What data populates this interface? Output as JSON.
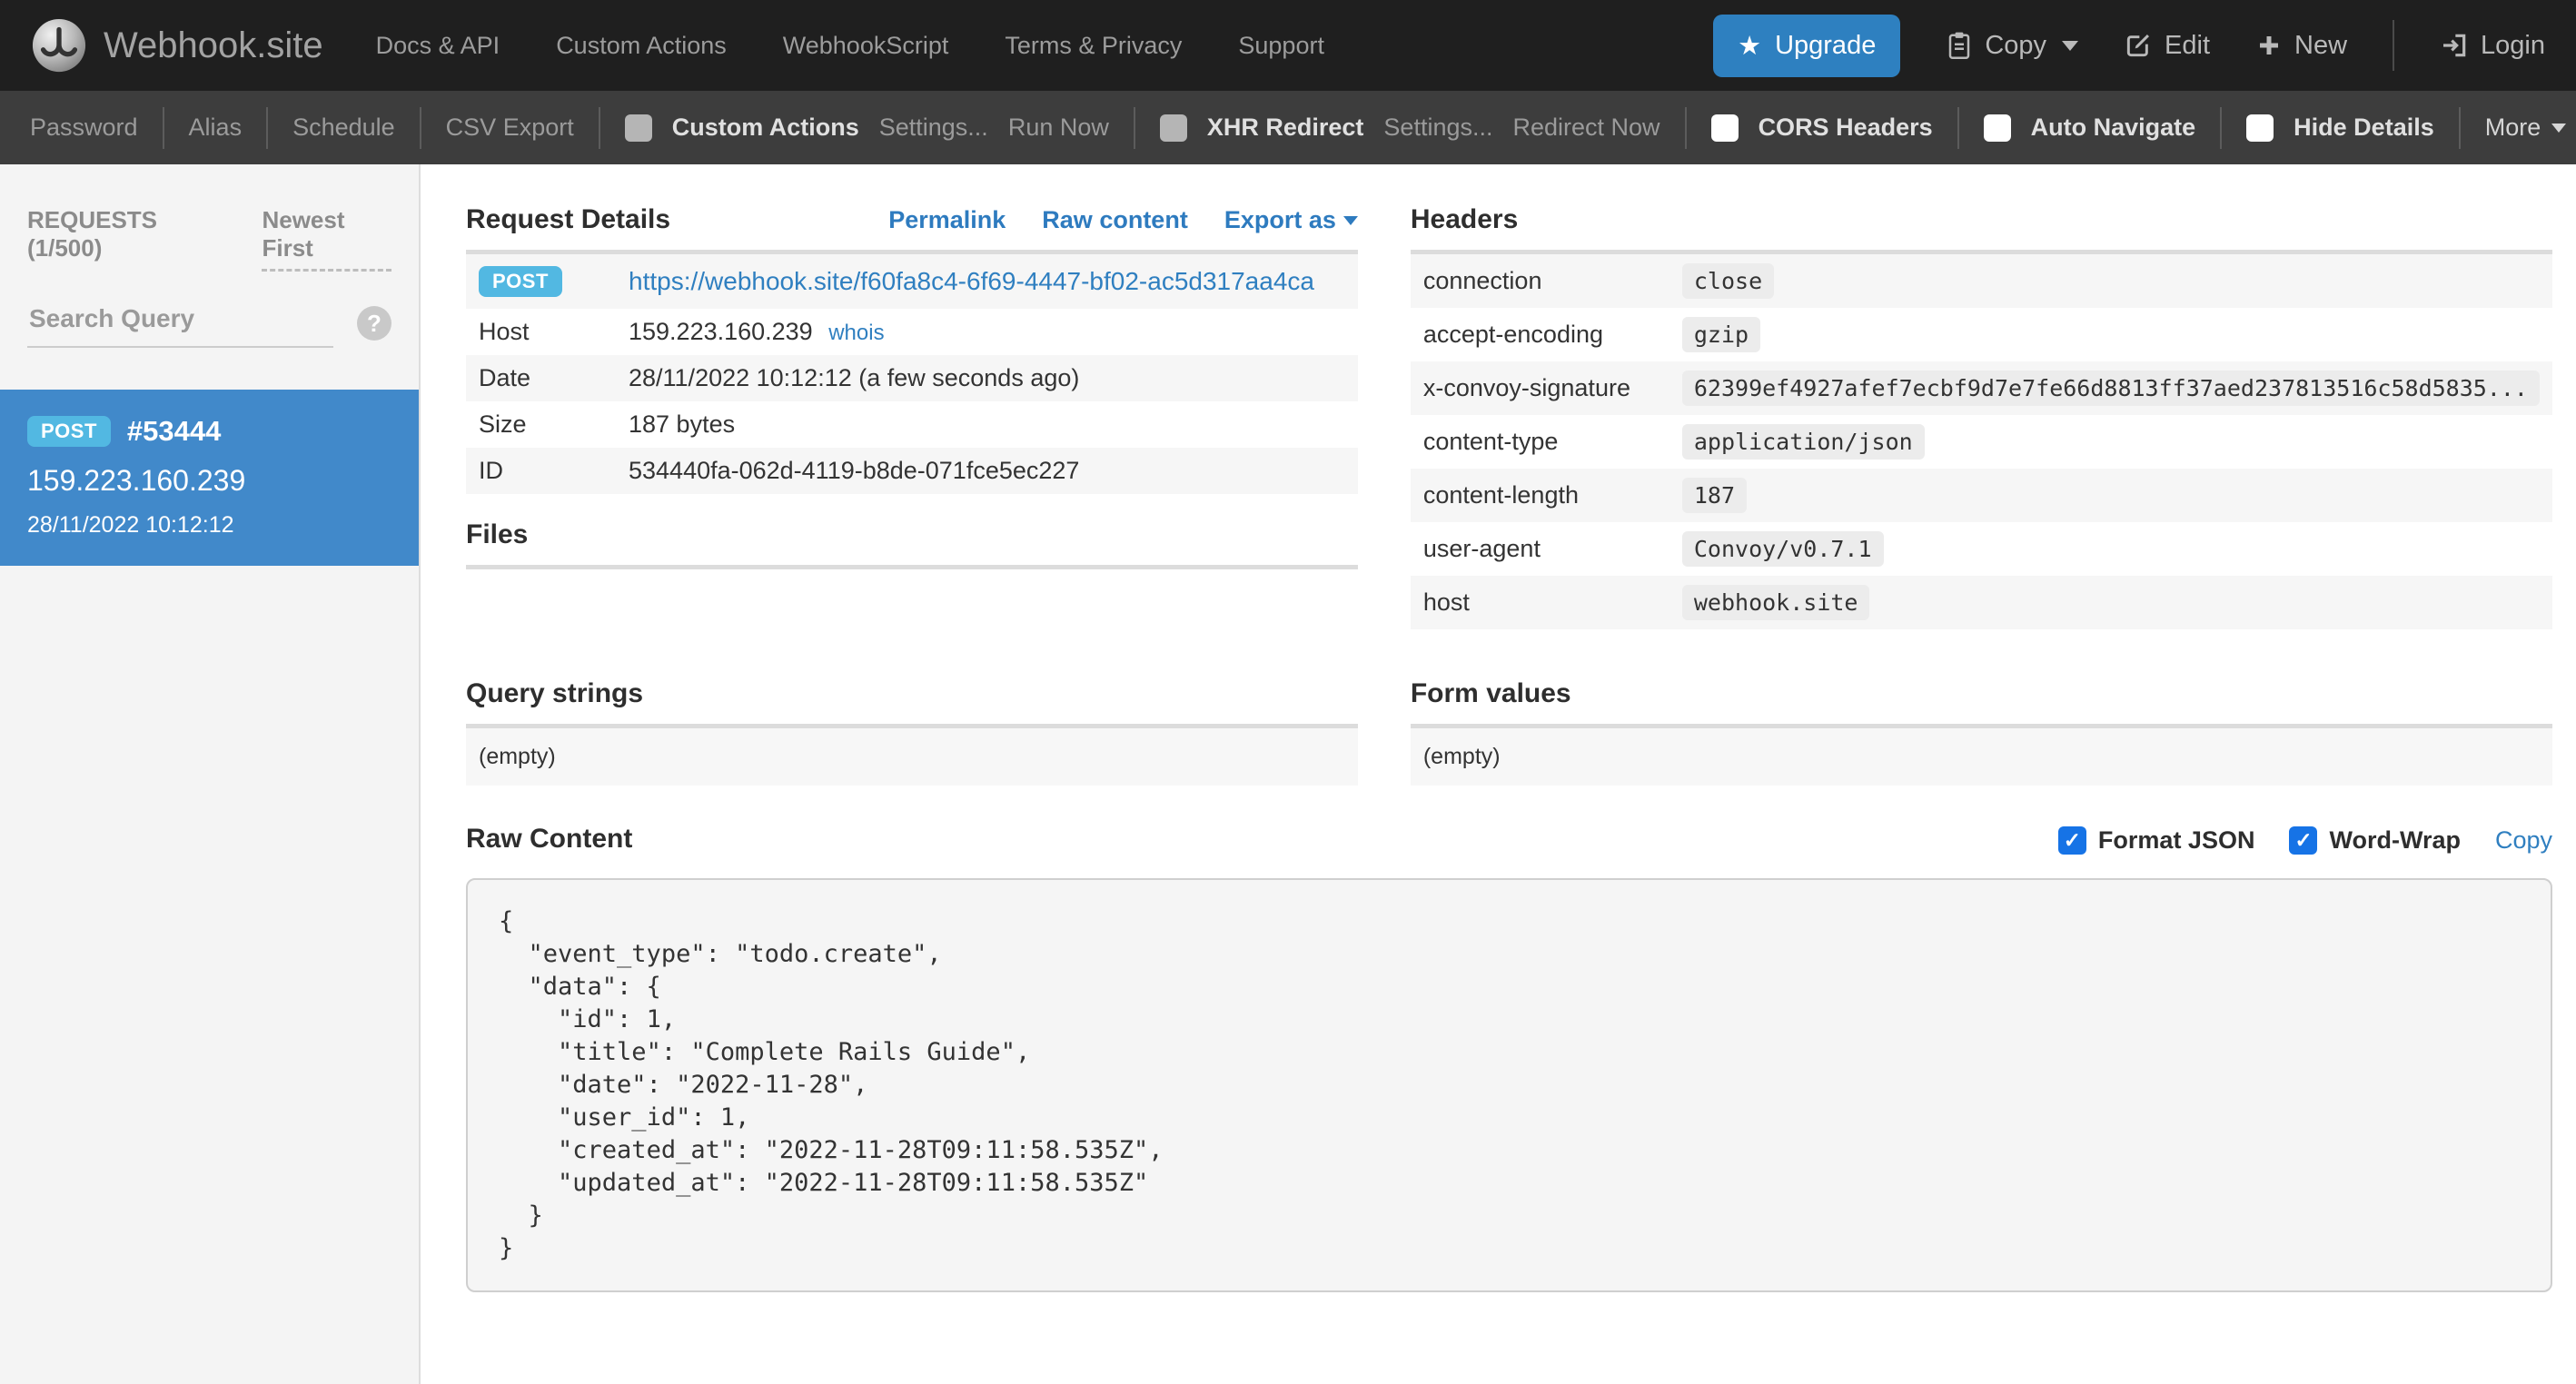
{
  "navbar": {
    "brand": "Webhook.site",
    "menu": [
      "Docs & API",
      "Custom Actions",
      "WebhookScript",
      "Terms & Privacy",
      "Support"
    ],
    "upgrade_label": "Upgrade",
    "copy_label": "Copy",
    "edit_label": "Edit",
    "new_label": "New",
    "login_label": "Login"
  },
  "toolbar": {
    "password": "Password",
    "alias": "Alias",
    "schedule": "Schedule",
    "csv_export": "CSV Export",
    "custom_actions": {
      "label": "Custom Actions",
      "settings": "Settings...",
      "run_now": "Run Now"
    },
    "xhr_redirect": {
      "label": "XHR Redirect",
      "settings": "Settings...",
      "redirect_now": "Redirect Now"
    },
    "cors_headers": "CORS Headers",
    "auto_navigate": "Auto Navigate",
    "hide_details": "Hide Details",
    "more": "More"
  },
  "sidebar": {
    "requests_count": "REQUESTS (1/500)",
    "sort": "Newest First",
    "search_placeholder": "Search Query",
    "help": "?",
    "item": {
      "method": "POST",
      "number": "#53444",
      "ip": "159.223.160.239",
      "datetime": "28/11/2022 10:12:12"
    }
  },
  "request_details": {
    "title": "Request Details",
    "links": {
      "permalink": "Permalink",
      "raw_content": "Raw content",
      "export_as": "Export as"
    },
    "method": "POST",
    "url": "https://webhook.site/f60fa8c4-6f69-4447-bf02-ac5d317aa4ca",
    "rows": [
      {
        "label": "Host",
        "value": "159.223.160.239",
        "link": "whois"
      },
      {
        "label": "Date",
        "value": "28/11/2022 10:12:12 (a few seconds ago)"
      },
      {
        "label": "Size",
        "value": "187 bytes"
      },
      {
        "label": "ID",
        "value": "534440fa-062d-4119-b8de-071fce5ec227"
      }
    ]
  },
  "files": {
    "title": "Files"
  },
  "query_strings": {
    "title": "Query strings",
    "empty": "(empty)"
  },
  "form_values": {
    "title": "Form values",
    "empty": "(empty)"
  },
  "headers": {
    "title": "Headers",
    "rows": [
      {
        "name": "connection",
        "value": "close"
      },
      {
        "name": "accept-encoding",
        "value": "gzip"
      },
      {
        "name": "x-convoy-signature",
        "value": "62399ef4927afef7ecbf9d7e7fe66d8813ff37aed237813516c58d5835..."
      },
      {
        "name": "content-type",
        "value": "application/json"
      },
      {
        "name": "content-length",
        "value": "187"
      },
      {
        "name": "user-agent",
        "value": "Convoy/v0.7.1"
      },
      {
        "name": "host",
        "value": "webhook.site"
      }
    ]
  },
  "raw_content": {
    "title": "Raw Content",
    "format_json_label": "Format JSON",
    "word_wrap_label": "Word-Wrap",
    "copy_label": "Copy",
    "body": "{\n  \"event_type\": \"todo.create\",\n  \"data\": {\n    \"id\": 1,\n    \"title\": \"Complete Rails Guide\",\n    \"date\": \"2022-11-28\",\n    \"user_id\": 1,\n    \"created_at\": \"2022-11-28T09:11:58.535Z\",\n    \"updated_at\": \"2022-11-28T09:11:58.535Z\"\n  }\n}"
  },
  "icons": {
    "star": "★",
    "check": "✓"
  },
  "colors": {
    "navbar_bg": "#1f1f1f",
    "toolbar_bg": "#3d3d3d",
    "upgrade_blue": "#2e80c0",
    "selected_item_blue": "#4189ca",
    "method_badge_cyan": "#52b8e2",
    "link_blue": "#2f7fc0",
    "checked_checkbox_blue": "#1673e6",
    "sidebar_bg": "#f4f4f4",
    "stripe_bg": "#f6f6f6"
  }
}
